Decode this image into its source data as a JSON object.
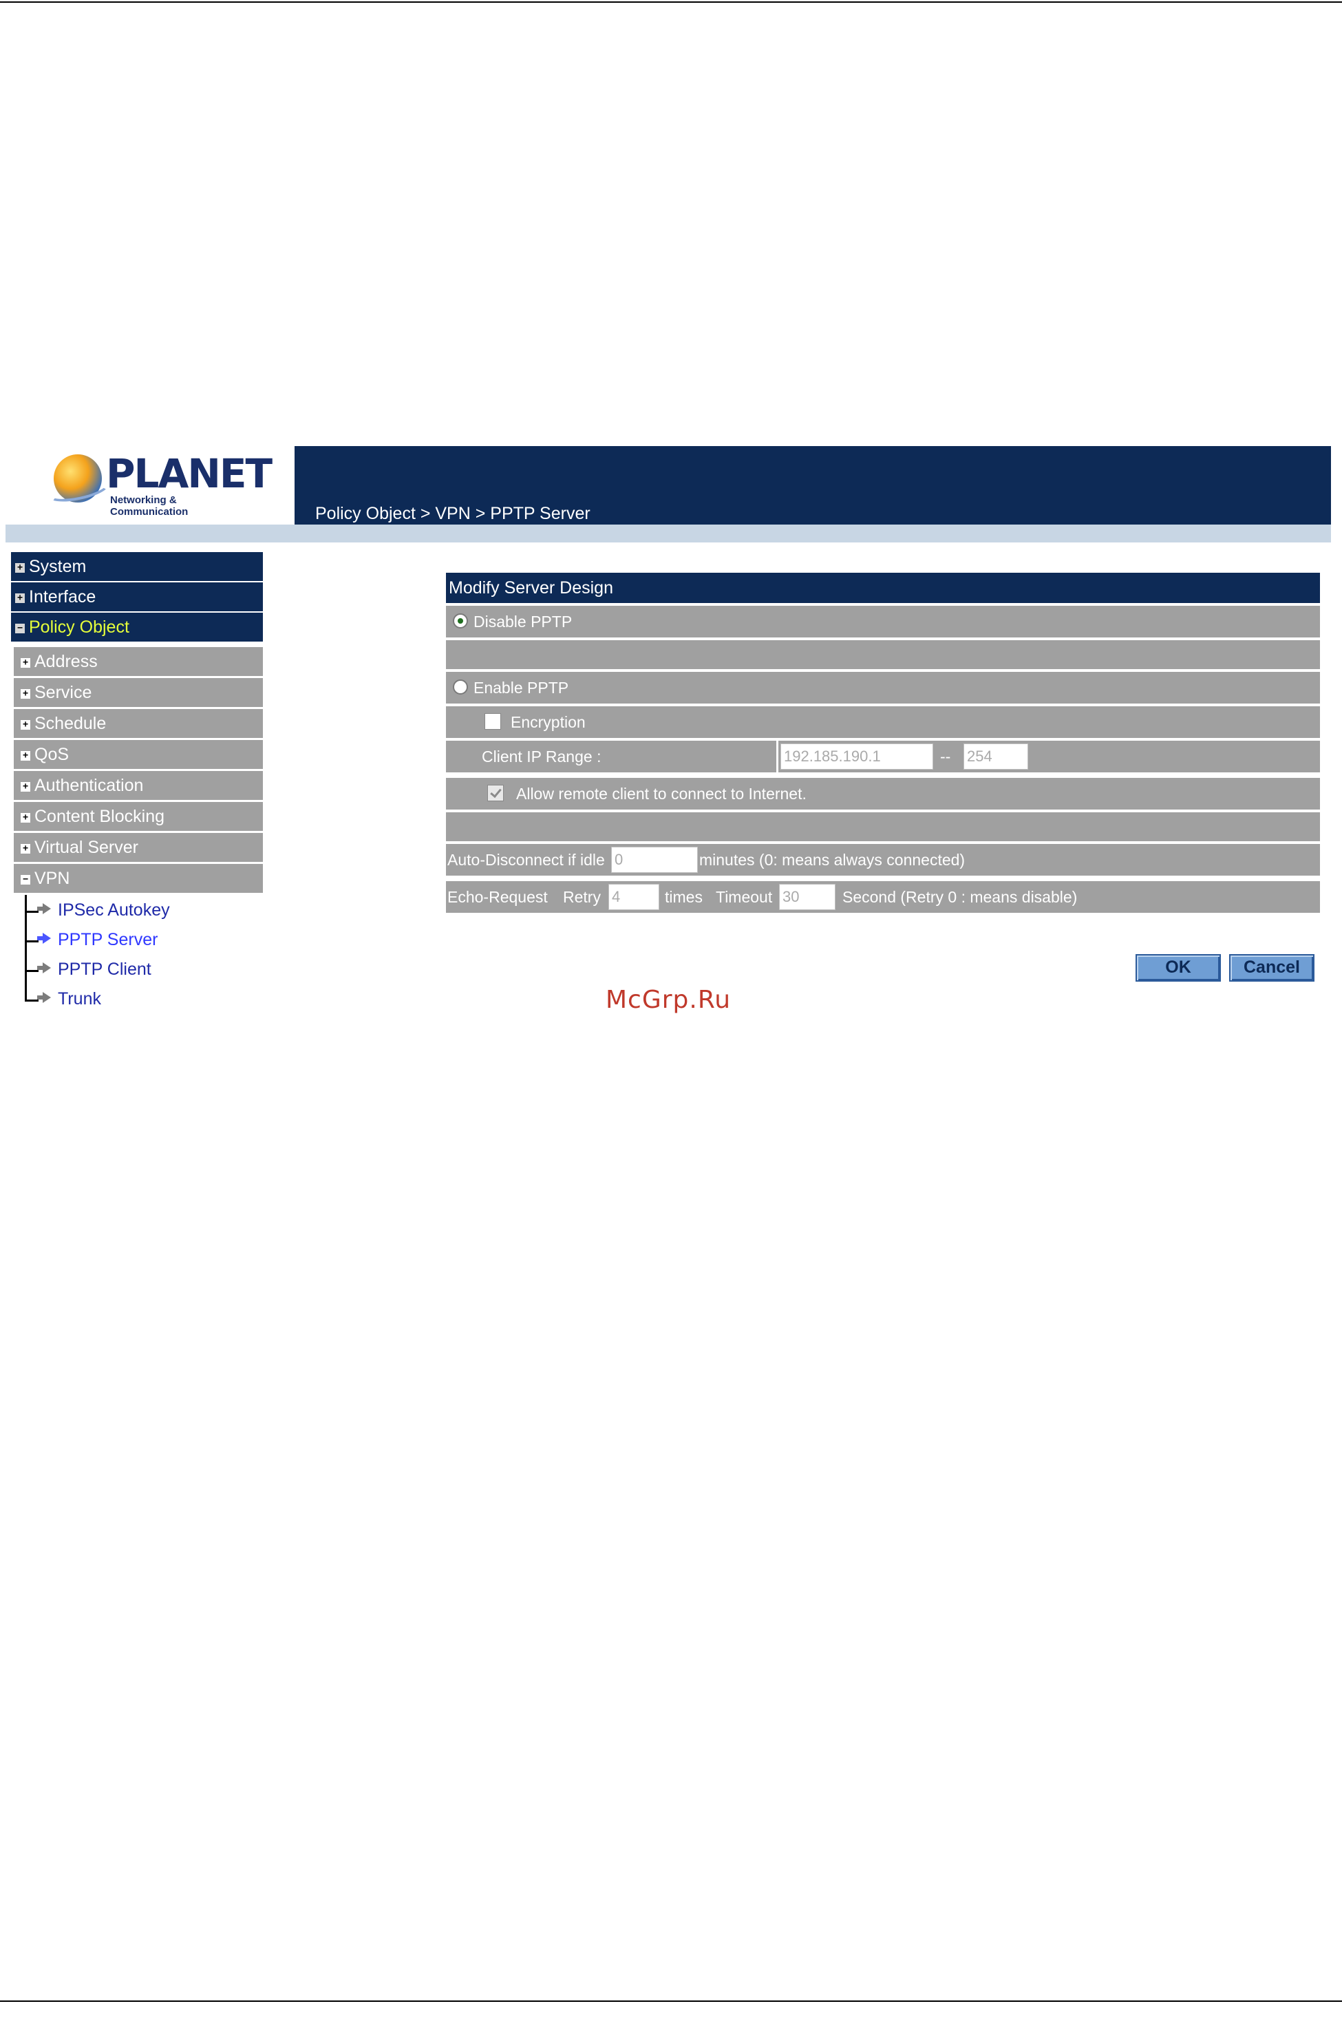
{
  "header": {
    "logo_brand": "PLANET",
    "logo_tagline": "Networking & Communication",
    "breadcrumb": "Policy Object > VPN > PPTP Server"
  },
  "sidebar": {
    "top_items": [
      {
        "label": "System",
        "icon": "plus-box-icon",
        "active": false
      },
      {
        "label": "Interface",
        "icon": "plus-box-icon",
        "active": false
      },
      {
        "label": "Policy Object",
        "icon": "minus-box-icon",
        "active": true
      }
    ],
    "sub_items": [
      {
        "label": "Address",
        "icon": "plus-box-icon"
      },
      {
        "label": "Service",
        "icon": "plus-box-icon"
      },
      {
        "label": "Schedule",
        "icon": "plus-box-icon"
      },
      {
        "label": "QoS",
        "icon": "plus-box-icon"
      },
      {
        "label": "Authentication",
        "icon": "plus-box-icon"
      },
      {
        "label": "Content Blocking",
        "icon": "plus-box-icon"
      },
      {
        "label": "Virtual Server",
        "icon": "plus-box-icon"
      },
      {
        "label": "VPN",
        "icon": "minus-box-icon"
      }
    ],
    "vpn_children": [
      {
        "label": "IPSec Autokey",
        "current": false
      },
      {
        "label": "PPTP Server",
        "current": true
      },
      {
        "label": "PPTP Client",
        "current": false
      },
      {
        "label": "Trunk",
        "current": false
      }
    ]
  },
  "form": {
    "title": "Modify Server Design",
    "disable_pptp": {
      "label": "Disable PPTP",
      "checked": true
    },
    "enable_pptp": {
      "label": "Enable PPTP",
      "checked": false
    },
    "encryption": {
      "label": "Encryption",
      "checked": false
    },
    "client_ip_range": {
      "label": "Client IP Range :",
      "start_value": "192.185.190.1",
      "separator": "--",
      "end_value": "254"
    },
    "allow_internet": {
      "label": "Allow remote client to connect to Internet.",
      "checked": true
    },
    "auto_disconnect": {
      "label": "Auto-Disconnect if idle",
      "value": "0",
      "suffix": "minutes (0: means always connected)"
    },
    "echo_request": {
      "label": "Echo-Request",
      "retry_label": "Retry",
      "retry_value": "4",
      "times_label": "times",
      "timeout_label": "Timeout",
      "timeout_value": "30",
      "suffix": "Second (Retry 0 : means disable)"
    },
    "ok_label": "OK",
    "cancel_label": "Cancel"
  },
  "watermark": "McGrp.Ru",
  "colors": {
    "nav_dark": "#0d2a56",
    "row_gray": "#a0a0a0",
    "active_nav_text": "#e6ff3a",
    "link_blue": "#1f2aa8"
  }
}
